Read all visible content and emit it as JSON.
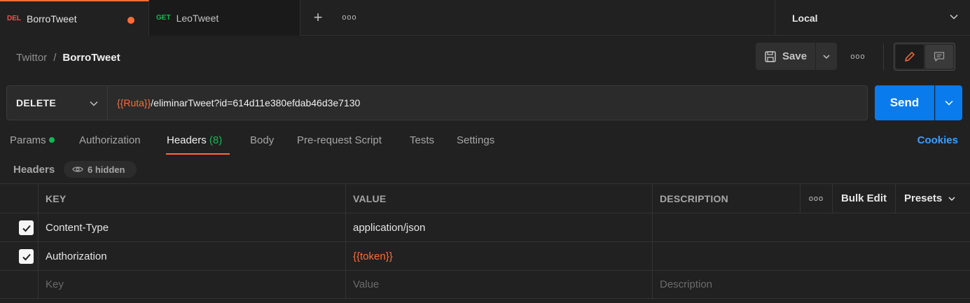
{
  "tabs": [
    {
      "method": "DEL",
      "method_color": "#ff4d4f",
      "title": "BorroTweet",
      "unsaved": true
    },
    {
      "method": "GET",
      "method_color": "#0cbb52",
      "title": "LeoTweet",
      "unsaved": false
    }
  ],
  "tab_more": "ooo",
  "environment": {
    "selected": "Local"
  },
  "breadcrumb": {
    "parent": "Twittor",
    "separator": "/",
    "current": "BorroTweet"
  },
  "toolbar": {
    "save_label": "Save",
    "more": "ooo"
  },
  "request": {
    "method": "DELETE",
    "url_variable": "{{Ruta}}",
    "url_path": "/eliminarTweet?id=614d11e380efdab46d3e7130",
    "send_label": "Send"
  },
  "request_tabs": {
    "params": "Params",
    "authorization": "Authorization",
    "headers": "Headers",
    "headers_count": "(8)",
    "body": "Body",
    "prerequest": "Pre-request Script",
    "tests": "Tests",
    "settings": "Settings",
    "cookies": "Cookies"
  },
  "headers_section": {
    "title": "Headers",
    "hidden": "6 hidden"
  },
  "table": {
    "columns": {
      "key": "KEY",
      "value": "VALUE",
      "description": "DESCRIPTION",
      "more": "ooo",
      "bulk_edit": "Bulk Edit",
      "presets": "Presets"
    },
    "rows": [
      {
        "checked": true,
        "key": "Content-Type",
        "value": "application/json",
        "value_is_variable": false
      },
      {
        "checked": true,
        "key": "Authorization",
        "value": "{{token}}",
        "value_is_variable": true
      }
    ],
    "placeholder": {
      "key": "Key",
      "value": "Value",
      "description": "Description"
    }
  }
}
